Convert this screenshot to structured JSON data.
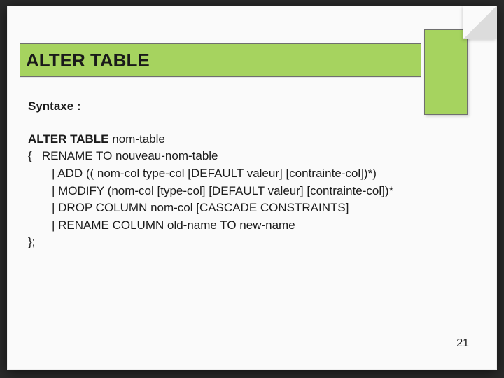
{
  "title": "ALTER TABLE",
  "subhead": "Syntaxe :",
  "code": {
    "l1_kw": "ALTER TABLE",
    "l1_rest": " nom-table",
    "l2": "{   RENAME TO nouveau-nom-table",
    "l3": "| ADD (( nom-col type-col [DEFAULT valeur] [contrainte-col])*)",
    "l4": "| MODIFY (nom-col [type-col] [DEFAULT valeur] [contrainte-col])*",
    "l5": "| DROP COLUMN nom-col [CASCADE CONSTRAINTS]",
    "l6": "| RENAME COLUMN old-name TO new-name",
    "l7": "};"
  },
  "page_number": "21"
}
